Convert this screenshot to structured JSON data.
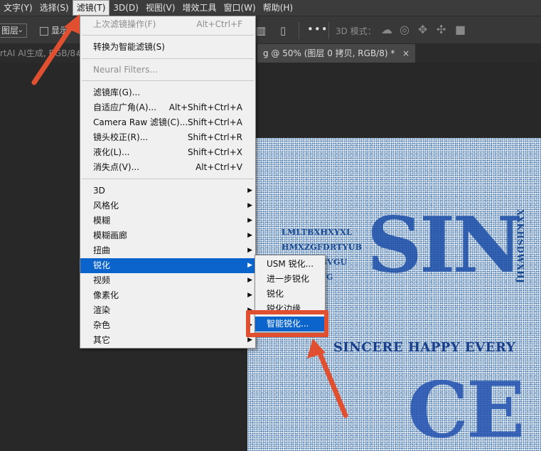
{
  "menubar": {
    "items": [
      {
        "label": "文字(Y)"
      },
      {
        "label": "选择(S)"
      },
      {
        "label": "滤镜(T)",
        "active": true
      },
      {
        "label": "3D(D)"
      },
      {
        "label": "视图(V)"
      },
      {
        "label": "增效工具"
      },
      {
        "label": "窗口(W)"
      },
      {
        "label": "帮助(H)"
      }
    ]
  },
  "options": {
    "layer_select": "图层",
    "show_label": "显示",
    "mode_3d_label": "3D 模式："
  },
  "tabs": {
    "doc1": "rtAI AI生成, RGB/8#)",
    "doc2": "g @ 50% (图层 0 拷贝, RGB/8) *",
    "close": "×"
  },
  "filter_menu": {
    "items": [
      {
        "label": "上次滤镜操作(F)",
        "shortcut": "Alt+Ctrl+F",
        "disabled": true
      },
      {
        "label": "转换为智能滤镜(S)",
        "shortcut": ""
      },
      {
        "label": "Neural Filters...",
        "shortcut": "",
        "disabled": true
      },
      {
        "label": "滤镜库(G)...",
        "shortcut": ""
      },
      {
        "label": "自适应广角(A)...",
        "shortcut": "Alt+Shift+Ctrl+A"
      },
      {
        "label": "Camera Raw 滤镜(C)...",
        "shortcut": "Shift+Ctrl+A"
      },
      {
        "label": "镜头校正(R)...",
        "shortcut": "Shift+Ctrl+R"
      },
      {
        "label": "液化(L)...",
        "shortcut": "Shift+Ctrl+X"
      },
      {
        "label": "消失点(V)...",
        "shortcut": "Alt+Ctrl+V"
      },
      {
        "label": "3D",
        "submenu": true
      },
      {
        "label": "风格化",
        "submenu": true
      },
      {
        "label": "模糊",
        "submenu": true
      },
      {
        "label": "模糊画廊",
        "submenu": true
      },
      {
        "label": "扭曲",
        "submenu": true
      },
      {
        "label": "锐化",
        "submenu": true,
        "highlighted": true
      },
      {
        "label": "视频",
        "submenu": true
      },
      {
        "label": "像素化",
        "submenu": true
      },
      {
        "label": "渲染",
        "submenu": true
      },
      {
        "label": "杂色",
        "submenu": true
      },
      {
        "label": "其它",
        "submenu": true
      }
    ]
  },
  "sharpen_submenu": {
    "items": [
      {
        "label": "USM 锐化..."
      },
      {
        "label": "进一步锐化"
      },
      {
        "label": "锐化"
      },
      {
        "label": "锐化边缘"
      },
      {
        "label": "智能锐化...",
        "highlighted": true
      }
    ]
  },
  "canvas": {
    "small_lines": [
      "LMLTBXHXYXL",
      "HMXZGFDRTYUB",
      "UZRTEBGVGU",
      "RTXKXRTG"
    ],
    "big_text_1": "SIN",
    "vertical_text": "XXKHSDWXHJ",
    "caption": "SINCERE  HAPPY  EVERY",
    "big_text_2": "CE"
  },
  "colors": {
    "accent_highlight": "#0a64cc",
    "annotation": "#e05030",
    "canvas_ink": "#1a4a93"
  }
}
